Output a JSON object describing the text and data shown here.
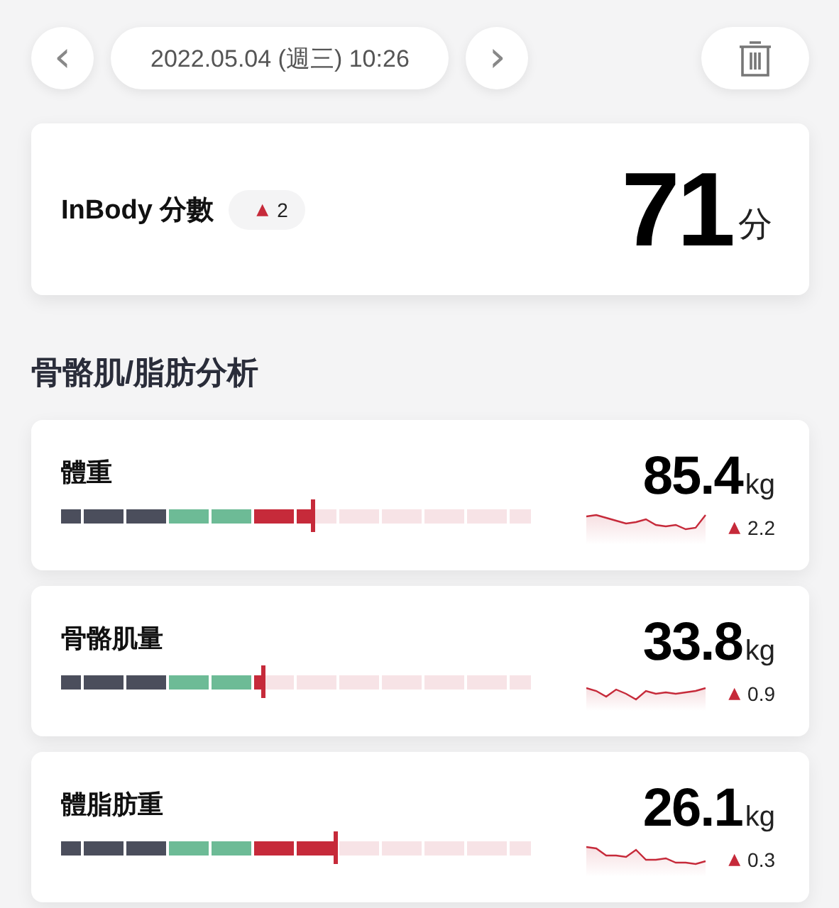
{
  "header": {
    "prev": "‹",
    "date": "2022.05.04 (週三) 10:26",
    "next": "›"
  },
  "score": {
    "label": "InBody 分數",
    "change": {
      "arrow": "▲",
      "value": "2"
    },
    "value": "71",
    "unit": "分"
  },
  "section_title": "骨骼肌/脂肪分析",
  "metrics": [
    {
      "name": "體重",
      "value": "85.4",
      "unit": "kg",
      "level": 0.54,
      "change": {
        "arrow": "▲",
        "value": "2.2"
      }
    },
    {
      "name": "骨骼肌量",
      "value": "33.8",
      "unit": "kg",
      "level": 0.435,
      "change": {
        "arrow": "▲",
        "value": "0.9"
      }
    },
    {
      "name": "體脂肪重",
      "value": "26.1",
      "unit": "kg",
      "level": 0.59,
      "change": {
        "arrow": "▲",
        "value": "0.3"
      }
    }
  ]
}
